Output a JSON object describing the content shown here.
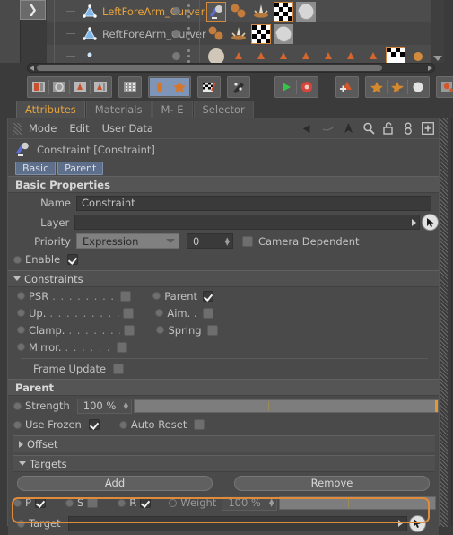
{
  "object_manager": {
    "collapse_icon": "chevron-right-icon",
    "rows": [
      {
        "name": "LeftForeArm_Curver",
        "selected": true,
        "icon": "null-object-icon",
        "tags": [
          "constraint-tag",
          "xpresso-tag",
          "protection-tag",
          "checker-texture-tag",
          "material-tag"
        ]
      },
      {
        "name": "ReftForeArm_Curver",
        "selected": false,
        "icon": "null-object-icon",
        "tags": [
          "xpresso-tag",
          "protection-tag",
          "checker-texture-tag",
          "material-tag"
        ]
      },
      {
        "name": "",
        "selected": false,
        "icon": "joint-icon",
        "tags": [
          "material-tag",
          "weight-tag",
          "weight-tag",
          "weight-tag",
          "weight-tag",
          "weight-tag",
          "weight-tag",
          "weight-tag",
          "checker-texture-tag",
          "sphere-tag"
        ]
      }
    ],
    "hscrollbar": "horizontal-scrollbar"
  },
  "toolbar": {
    "groups": [
      {
        "buttons": [
          {
            "icon": "make-editable-icon",
            "active": false
          },
          {
            "icon": "model-axis-icon",
            "active": false
          },
          {
            "icon": "object-axis-icon",
            "active": false
          },
          {
            "icon": "texture-axis-icon",
            "active": false
          }
        ]
      },
      {
        "buttons": [
          {
            "icon": "points-grid-icon",
            "active": false
          }
        ]
      },
      {
        "buttons": [
          {
            "icon": "enable-axis-icon",
            "active": true
          },
          {
            "icon": "enable-snap-icon",
            "active": true
          }
        ]
      },
      {
        "buttons": [
          {
            "icon": "workplane-icon",
            "active": false
          }
        ]
      },
      {
        "buttons": [
          {
            "icon": "paint-brush-icon",
            "active": false
          }
        ]
      },
      {
        "buttons": [
          {
            "icon": "play-icon",
            "active": false
          },
          {
            "icon": "record-icon",
            "active": false
          }
        ]
      },
      {
        "buttons": [
          {
            "icon": "add-keyframe-icon",
            "active": false
          }
        ]
      },
      {
        "buttons": [
          {
            "icon": "keyframe-star-icon",
            "active": false
          },
          {
            "icon": "keyframe-star-zero-icon",
            "active": false
          },
          {
            "icon": "keyframe-circle-icon",
            "active": false
          }
        ]
      },
      {
        "buttons": [
          {
            "icon": "autokey-icon",
            "active": false
          }
        ]
      }
    ]
  },
  "tabs": [
    {
      "label": "Attributes",
      "active": true
    },
    {
      "label": "Materials",
      "active": false
    },
    {
      "label": "M- E",
      "active": false
    },
    {
      "label": "Selector",
      "active": false
    }
  ],
  "attribute_manager": {
    "menu": [
      "Mode",
      "Edit",
      "User Data"
    ],
    "tools": [
      "back-arrow-icon",
      "forward-arrow-icon",
      "up-arrow-icon",
      "search-icon",
      "unlock-icon",
      "chain-link-icon",
      "new-window-icon"
    ],
    "object_icon": "constraint-tag-icon",
    "object_title": "Constraint [Constraint]",
    "subtabs": [
      {
        "label": "Basic",
        "active": true
      },
      {
        "label": "Parent",
        "active": false
      }
    ],
    "basic_properties": {
      "header": "Basic Properties",
      "name_label": "Name",
      "name_value": "Constraint",
      "layer_label": "Layer",
      "layer_value": "",
      "layer_placeholder": "",
      "priority_label": "Priority",
      "priority_value": "Expression",
      "priority_number": "0",
      "camera_dependent_label": "Camera Dependent",
      "camera_dependent_checked": false,
      "enable_label": "Enable",
      "enable_checked": true
    },
    "constraints": {
      "header": "Constraints",
      "expanded": true,
      "left_items": [
        {
          "label": "PSR",
          "dots": ". . . . . . . . .",
          "checked": false
        },
        {
          "label": "Up.",
          "dots": ". . . . . . . . .",
          "checked": false
        },
        {
          "label": "Clamp.",
          "dots": ". . . . . . .",
          "checked": false
        },
        {
          "label": "Mirror.",
          "dots": ". . . . . . .",
          "checked": false
        }
      ],
      "right_items": [
        {
          "label": "Parent",
          "dots": "",
          "checked": true
        },
        {
          "label": "Aim. .",
          "dots": "",
          "checked": false
        },
        {
          "label": "Spring",
          "dots": "",
          "checked": false
        }
      ],
      "frame_update_label": "Frame Update",
      "frame_update_checked": false
    },
    "parent": {
      "header": "Parent",
      "strength_label": "Strength",
      "strength_value": "100 %",
      "strength_percent": 100,
      "use_frozen_label": "Use Frozen",
      "use_frozen_checked": true,
      "auto_reset_label": "Auto Reset",
      "auto_reset_checked": false,
      "offset_header": "Offset",
      "offset_expanded": false,
      "targets_header": "Targets",
      "targets_expanded": true,
      "add_button": "Add",
      "remove_button": "Remove",
      "flags": [
        {
          "label": "P",
          "checked": true
        },
        {
          "label": "S",
          "checked": false
        },
        {
          "label": "R",
          "checked": true
        }
      ],
      "weight_label": "Weight",
      "weight_value": "100 %",
      "weight_percent": 100,
      "target_label": "Target",
      "target_value": "",
      "target_highlighted": true,
      "target_picker_icon": "cursor-picker-icon"
    }
  },
  "colors": {
    "accent_orange": "#e6a33a",
    "highlight_border": "#e08a3c",
    "panel_bg": "#4a4a4a",
    "window_bg": "#3b3b3b",
    "field_bg": "#3a3a3a",
    "subtab_blue": "#5e6f8c"
  }
}
